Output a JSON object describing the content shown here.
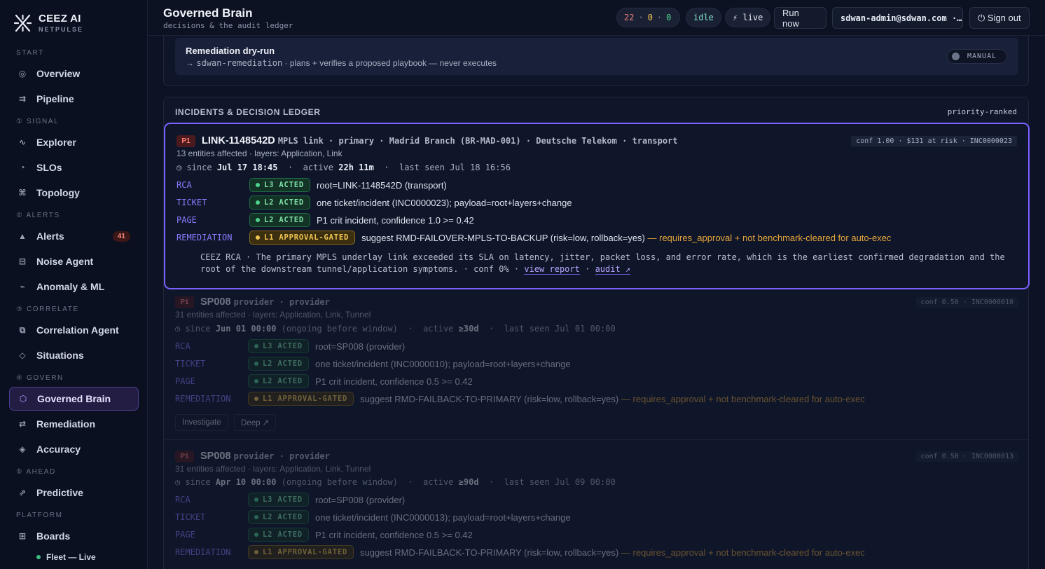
{
  "brand": {
    "name": "CEEZ AI",
    "sub": "NETPULSE"
  },
  "nav": {
    "sections": {
      "start": "START",
      "signal": "① SIGNAL",
      "alerts": "② ALERTS",
      "correlate": "③ CORRELATE",
      "govern": "④ GOVERN",
      "ahead": "⑤ AHEAD",
      "platform": "PLATFORM"
    },
    "items": {
      "overview": "Overview",
      "pipeline": "Pipeline",
      "explorer": "Explorer",
      "slos": "SLOs",
      "topology": "Topology",
      "alerts": "Alerts",
      "alerts_count": "41",
      "noise": "Noise Agent",
      "anomaly": "Anomaly & ML",
      "correlation": "Correlation Agent",
      "situations": "Situations",
      "governed": "Governed Brain",
      "remediation": "Remediation",
      "accuracy": "Accuracy",
      "predictive": "Predictive",
      "boards": "Boards",
      "fleet": "Fleet — Live"
    }
  },
  "header": {
    "title": "Governed Brain",
    "subtitle": "decisions & the audit ledger",
    "c_red": "22",
    "c_yel": "0",
    "c_grn": "0",
    "sep": "·",
    "status": "idle",
    "live": "⚡ live",
    "run": "Run now",
    "user": "sdwan-admin@sdwan.com ·…",
    "signout": "⏻ Sign out"
  },
  "dryrun": {
    "title": "Remediation dry-run",
    "arrow": "→",
    "target": "sdwan-remediation",
    "desc": " · plans + verifies a proposed playbook — never executes",
    "mode": "MANUAL"
  },
  "ledger": {
    "title": "INCIDENTS & DECISION LEDGER",
    "sort": "priority-ranked",
    "row_labels": {
      "rca": "RCA",
      "ticket": "TICKET",
      "page": "PAGE",
      "rem": "REMEDIATION"
    },
    "tags": {
      "l3": "L3 ACTED",
      "l2": "L2 ACTED",
      "l1": "L1 APPROVAL-GATED"
    },
    "priority": "P1",
    "since_label": "◷ since",
    "active_label": "active",
    "last_label": "last seen",
    "dot": "·",
    "investigate": "Investigate",
    "deep": "Deep ↗"
  },
  "incidents": [
    {
      "id": "LINK-1148542D",
      "desc": "MPLS link · primary · Madrid Branch (BR-MAD-001) · Deutsche Telekom · transport",
      "conf": "conf 1.00 · $131 at risk · INC0000023",
      "entities": "13 entities affected · layers: Application, Link",
      "since": "Jul 17 18:45",
      "pre": "",
      "active": "22h 11m",
      "last": "Jul 18 16:56",
      "rca": "root=LINK-1148542D (transport)",
      "ticket": "one ticket/incident (INC0000023); payload=root+layers+change",
      "page": "P1 crit incident, confidence 1.0 >= 0.42",
      "rem": "suggest RMD-FAILOVER-MPLS-TO-BACKUP (risk=low, rollback=yes)",
      "warn": "— requires_approval + not benchmark-cleared for auto-exec",
      "summary": "CEEZ RCA · The primary MPLS underlay link exceeded its SLA on latency, jitter, packet loss, and error rate, which is the earliest confirmed degradation and the root of the downstream tunnel/application symptoms. · conf 0% · ",
      "view": "view report",
      "audit": "audit ↗"
    },
    {
      "id": "SP008",
      "desc": "provider · provider",
      "conf": "conf 0.50 · INC0000010",
      "entities": "31 entities affected · layers: Application, Link, Tunnel",
      "since": "Jun 01 00:00",
      "pre": "(ongoing before window)",
      "active": "≥30d",
      "last": "Jul 01 00:00",
      "rca": "root=SP008 (provider)",
      "ticket": "one ticket/incident (INC0000010); payload=root+layers+change",
      "page": "P1 crit incident, confidence 0.5 >= 0.42",
      "rem": "suggest RMD-FAILBACK-TO-PRIMARY (risk=low, rollback=yes)",
      "warn": "— requires_approval + not benchmark-cleared for auto-exec"
    },
    {
      "id": "SP008",
      "desc": "provider · provider",
      "conf": "conf 0.50 · INC0000013",
      "entities": "31 entities affected · layers: Application, Link, Tunnel",
      "since": "Apr 10 00:00",
      "pre": "(ongoing before window)",
      "active": "≥90d",
      "last": "Jul 09 00:00",
      "rca": "root=SP008 (provider)",
      "ticket": "one ticket/incident (INC0000013); payload=root+layers+change",
      "page": "P1 crit incident, confidence 0.5 >= 0.42",
      "rem": "suggest RMD-FAILBACK-TO-PRIMARY (risk=low, rollback=yes)",
      "warn": "— requires_approval + not benchmark-cleared for auto-exec"
    }
  ]
}
